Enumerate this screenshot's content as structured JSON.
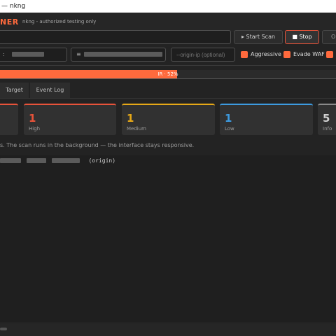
{
  "window": {
    "title": "— nkng"
  },
  "header": {
    "brand": "NER",
    "subtitle": "nkng - authorized testing only"
  },
  "toolbar": {
    "target_value": "",
    "start_label": "▸  Start Scan",
    "stop_label": "■  Stop",
    "options_label": "Op"
  },
  "fields": {
    "field1_label": ":",
    "field2_prefix": "≡",
    "origin_ip_placeholder": "--origin-ip (optional)"
  },
  "checkboxes": [
    {
      "label": "Aggressive",
      "checked": true
    },
    {
      "label": "Evade WAF",
      "checked": true
    },
    {
      "label": "",
      "checked": true
    }
  ],
  "progress": {
    "percent": 52,
    "label": "IR · 52%"
  },
  "tabs": [
    "Target",
    "Event Log"
  ],
  "cards": [
    {
      "count": "",
      "label": "",
      "color": "#e8533a"
    },
    {
      "count": "1",
      "label": "High",
      "color": "#e8533a"
    },
    {
      "count": "1",
      "label": "Medium",
      "color": "#e6a817"
    },
    {
      "count": "1",
      "label": "Low",
      "color": "#3d9be0"
    },
    {
      "count": "5",
      "label": "Info",
      "color": "#8a8a8a"
    }
  ],
  "note": "s. The scan runs in the background — the interface stays responsive.",
  "log": {
    "origin_tag": "(origin)"
  },
  "colors": {
    "accent": "#ff6a3d",
    "background": "#232323"
  }
}
